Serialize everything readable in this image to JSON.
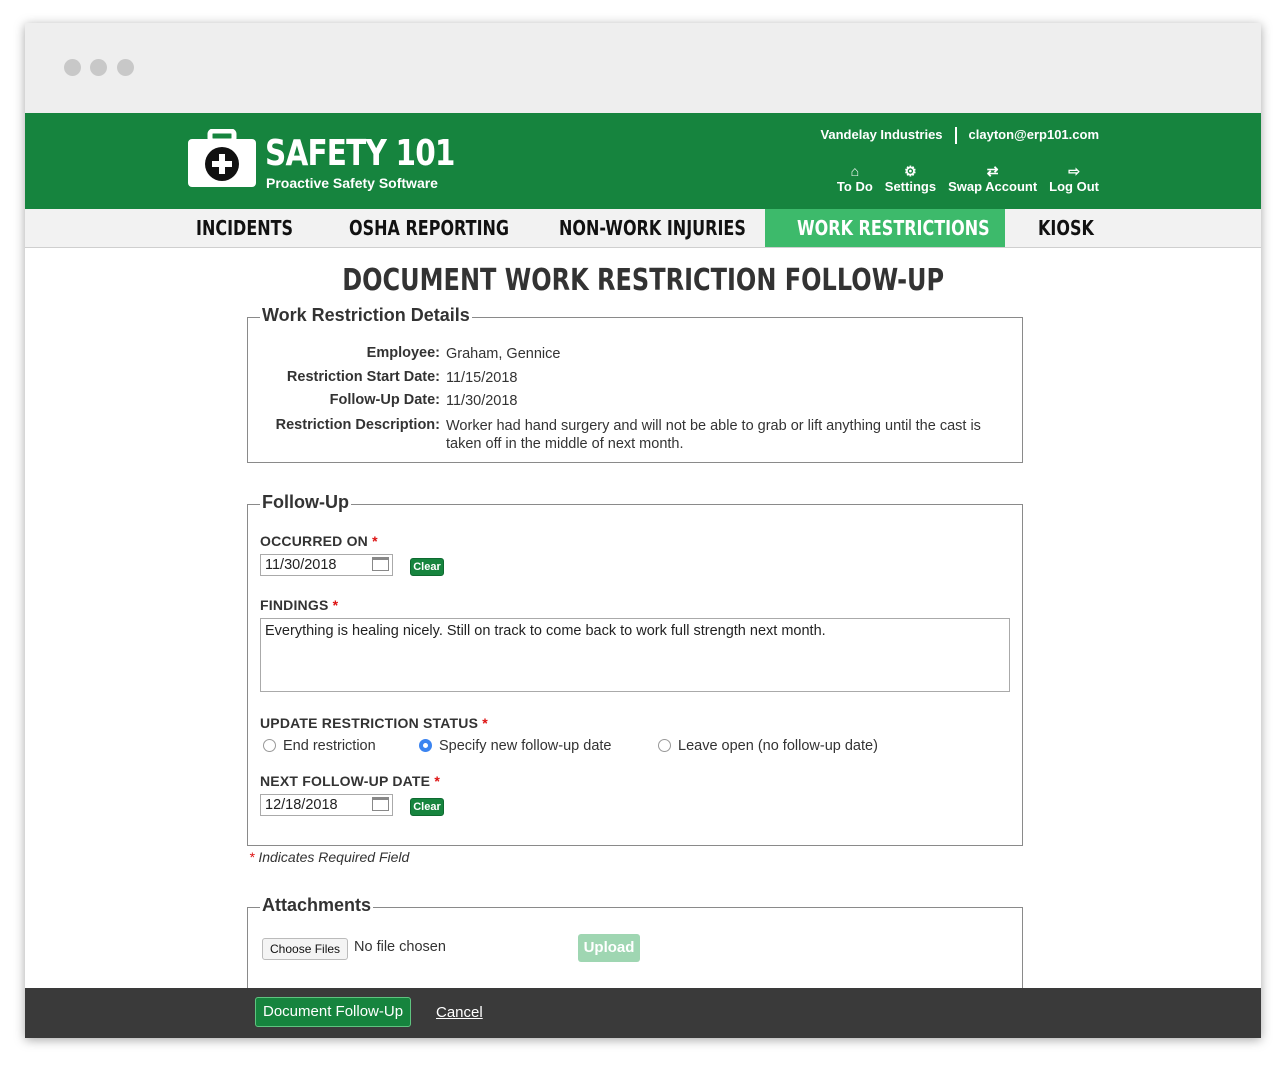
{
  "app": {
    "title": "SAFETY 101",
    "subtitle": "Proactive Safety Software"
  },
  "account": {
    "company": "Vandelay Industries",
    "email": "clayton@erp101.com"
  },
  "toplinks": [
    {
      "label": "To Do",
      "icon": "home-icon"
    },
    {
      "label": "Settings",
      "icon": "gear-icon"
    },
    {
      "label": "Swap Account",
      "icon": "swap-arrows-icon"
    },
    {
      "label": "Log Out",
      "icon": "logout-icon"
    }
  ],
  "nav": {
    "items": [
      "INCIDENTS",
      "OSHA REPORTING",
      "NON-WORK INJURIES",
      "WORK RESTRICTIONS",
      "KIOSK"
    ],
    "active": "WORK RESTRICTIONS"
  },
  "page": {
    "title": "DOCUMENT WORK RESTRICTION FOLLOW-UP"
  },
  "details": {
    "legend": "Work Restriction Details",
    "rows": [
      {
        "label": "Employee:",
        "value": "Graham, Gennice"
      },
      {
        "label": "Restriction Start Date:",
        "value": "11/15/2018"
      },
      {
        "label": "Follow-Up Date:",
        "value": "11/30/2018"
      },
      {
        "label": "Restriction Description:",
        "value": "Worker had hand surgery and will not be able to grab or lift anything until the cast is taken off in the middle of next month."
      }
    ]
  },
  "followup": {
    "legend": "Follow-Up",
    "occurred_label": "OCCURRED ON",
    "occurred_value": "11/30/2018",
    "clear_label": "Clear",
    "findings_label": "FINDINGS",
    "findings_value": "Everything is healing nicely. Still on track to come back to work full strength next month.",
    "status_label": "UPDATE RESTRICTION STATUS",
    "status_options": [
      "End restriction",
      "Specify new follow-up date",
      "Leave open (no follow-up date)"
    ],
    "status_selected": "Specify new follow-up date",
    "next_label": "NEXT FOLLOW-UP DATE",
    "next_value": "12/18/2018",
    "required_mark": "*"
  },
  "required_note": "Indicates Required Field",
  "attachments": {
    "legend": "Attachments",
    "choose_label": "Choose Files",
    "no_file": "No file chosen",
    "upload_label": "Upload"
  },
  "footer": {
    "submit_label": "Document Follow-Up",
    "cancel_label": "Cancel"
  },
  "colors": {
    "brand_green": "#16843e",
    "active_tab": "#3dba6b",
    "footer_bar": "#3a3a3a"
  }
}
